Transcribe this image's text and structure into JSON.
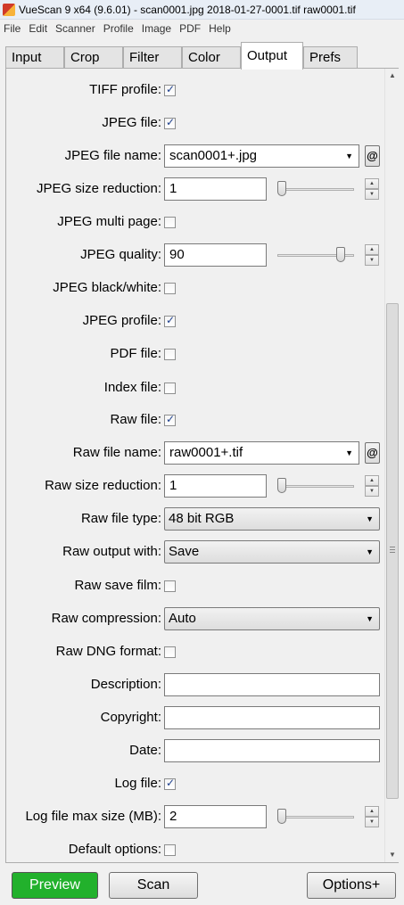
{
  "window": {
    "title": "VueScan 9 x64 (9.6.01) - scan0001.jpg 2018-01-27-0001.tif raw0001.tif"
  },
  "menu": [
    "File",
    "Edit",
    "Scanner",
    "Profile",
    "Image",
    "PDF",
    "Help"
  ],
  "tabs": [
    {
      "label": "Input",
      "active": false
    },
    {
      "label": "Crop",
      "active": false
    },
    {
      "label": "Filter",
      "active": false
    },
    {
      "label": "Color",
      "active": false
    },
    {
      "label": "Output",
      "active": true
    },
    {
      "label": "Prefs",
      "active": false
    }
  ],
  "output": {
    "tiff_profile": {
      "label": "TIFF profile:",
      "checked": true
    },
    "jpeg_file": {
      "label": "JPEG file:",
      "checked": true
    },
    "jpeg_file_name": {
      "label": "JPEG file name:",
      "value": "scan0001+.jpg",
      "at_button": "@"
    },
    "jpeg_size_reduction": {
      "label": "JPEG size reduction:",
      "value": "1",
      "slider_fraction": 0.0
    },
    "jpeg_multi_page": {
      "label": "JPEG multi page:",
      "checked": false
    },
    "jpeg_quality": {
      "label": "JPEG quality:",
      "value": "90",
      "slider_fraction": 0.85
    },
    "jpeg_black_white": {
      "label": "JPEG black/white:",
      "checked": false
    },
    "jpeg_profile": {
      "label": "JPEG profile:",
      "checked": true
    },
    "pdf_file": {
      "label": "PDF file:",
      "checked": false
    },
    "index_file": {
      "label": "Index file:",
      "checked": false
    },
    "raw_file": {
      "label": "Raw file:",
      "checked": true
    },
    "raw_file_name": {
      "label": "Raw file name:",
      "value": "raw0001+.tif",
      "at_button": "@"
    },
    "raw_size_reduction": {
      "label": "Raw size reduction:",
      "value": "1",
      "slider_fraction": 0.0
    },
    "raw_file_type": {
      "label": "Raw file type:",
      "value": "48 bit RGB"
    },
    "raw_output_with": {
      "label": "Raw output with:",
      "value": "Save"
    },
    "raw_save_film": {
      "label": "Raw save film:",
      "checked": false
    },
    "raw_compression": {
      "label": "Raw compression:",
      "value": "Auto"
    },
    "raw_dng_format": {
      "label": "Raw DNG format:",
      "checked": false
    },
    "description": {
      "label": "Description:",
      "value": ""
    },
    "copyright": {
      "label": "Copyright:",
      "value": ""
    },
    "date": {
      "label": "Date:",
      "value": ""
    },
    "log_file": {
      "label": "Log file:",
      "checked": true
    },
    "log_file_max_size": {
      "label": "Log file max size (MB):",
      "value": "2",
      "slider_fraction": 0.0
    },
    "default_options": {
      "label": "Default options:",
      "checked": false
    }
  },
  "buttons": {
    "preview": "Preview",
    "scan": "Scan",
    "options": "Options+"
  },
  "colors": {
    "preview_button": "#22b12c",
    "checkmark": "#1c3e8c"
  },
  "icons": {
    "scroll_up": "▲",
    "scroll_down": "▼",
    "combo_arrow": "▼",
    "spin_up": "▲",
    "spin_down": "▼"
  }
}
